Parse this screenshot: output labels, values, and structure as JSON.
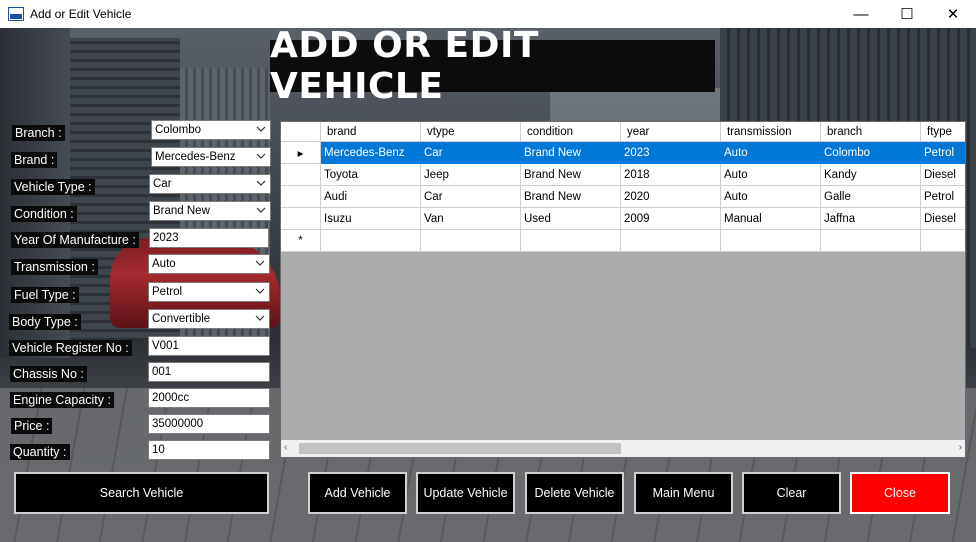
{
  "window": {
    "title": "Add or Edit Vehicle",
    "minimize_glyph": "—",
    "maximize_glyph": "☐",
    "close_glyph": "✕"
  },
  "heading": "ADD OR EDIT VEHICLE",
  "form": {
    "branch_label": "Branch :",
    "branch_value": "Colombo",
    "brand_label": "Brand :",
    "brand_value": "Mercedes-Benz",
    "vehicle_type_label": "Vehicle Type :",
    "vehicle_type_value": "Car",
    "condition_label": "Condition :",
    "condition_value": "Brand New",
    "year_label": "Year Of Manufacture :",
    "year_value": "2023",
    "transmission_label": "Transmission :",
    "transmission_value": "Auto",
    "fuel_type_label": "Fuel Type :",
    "fuel_type_value": "Petrol",
    "body_type_label": "Body Type :",
    "body_type_value": "Convertible",
    "register_no_label": "Vehicle Register No :",
    "register_no_value": "V001",
    "chassis_label": "Chassis No :",
    "chassis_value": "001",
    "engine_label": "Engine Capacity :",
    "engine_value": "2000cc",
    "price_label": "Price :",
    "price_value": "35000000",
    "quantity_label": "Quantity :",
    "quantity_value": "10"
  },
  "grid": {
    "columns": [
      "brand",
      "vtype",
      "condition",
      "year",
      "transmission",
      "branch",
      "ftype"
    ],
    "rows": [
      [
        "Mercedes-Benz",
        "Car",
        "Brand New",
        "2023",
        "Auto",
        "Colombo",
        "Petrol"
      ],
      [
        "Toyota",
        "Jeep",
        "Brand New",
        "2018",
        "Auto",
        "Kandy",
        "Diesel"
      ],
      [
        "Audi",
        "Car",
        "Brand New",
        "2020",
        "Auto",
        "Galle",
        "Petrol"
      ],
      [
        "Isuzu",
        "Van",
        "Used",
        "2009",
        "Manual",
        "Jaffna",
        "Diesel"
      ]
    ],
    "selected_marker": "▸",
    "new_row_marker": "*",
    "scroll_left": "‹",
    "scroll_right": "›"
  },
  "buttons": {
    "search": "Search Vehicle",
    "add": "Add Vehicle",
    "update": "Update Vehicle",
    "delete": "Delete Vehicle",
    "main_menu": "Main Menu",
    "clear": "Clear",
    "close": "Close"
  },
  "colors": {
    "selection": "#0078d7",
    "close_button": "#ff0000",
    "label_bg": "#0a0a0a"
  }
}
